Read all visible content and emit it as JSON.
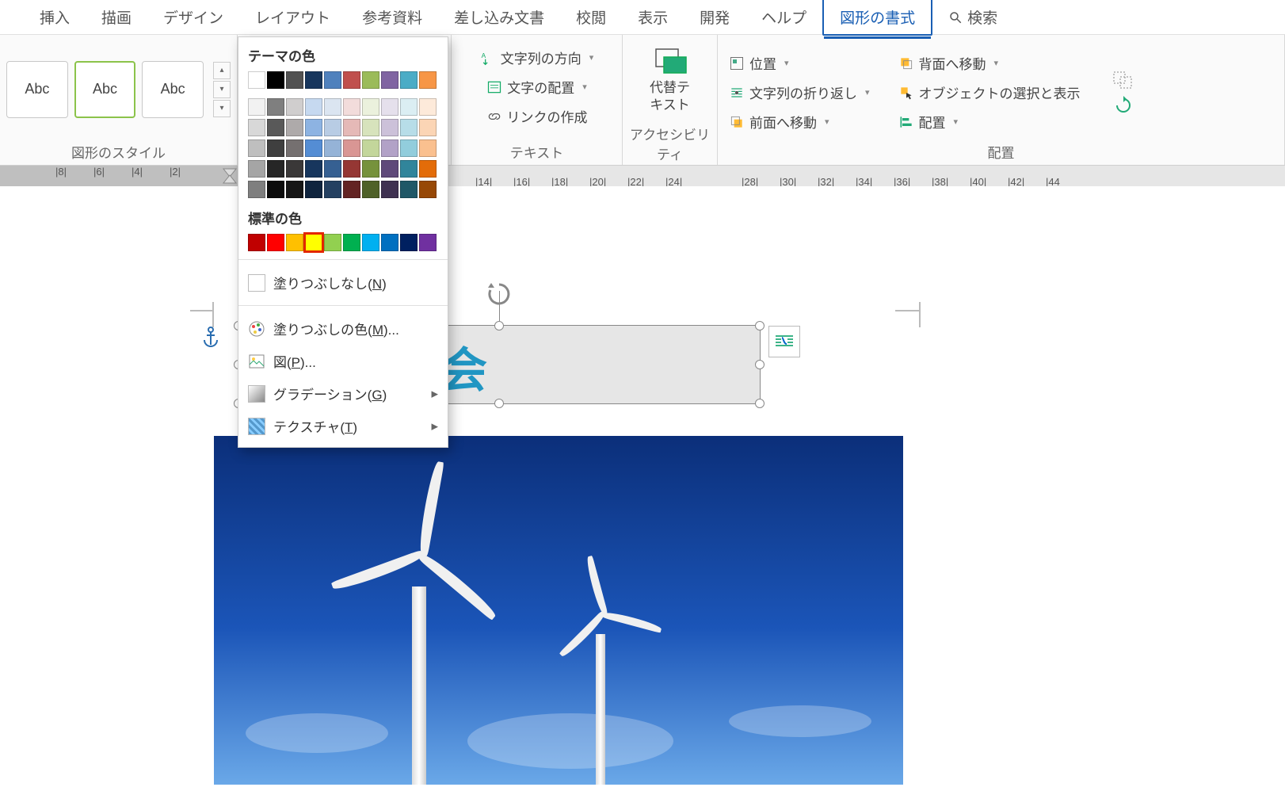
{
  "tabs": {
    "insert": "挿入",
    "draw": "描画",
    "design": "デザイン",
    "layout": "レイアウト",
    "references": "参考資料",
    "mailings": "差し込み文書",
    "review": "校閲",
    "view": "表示",
    "developer": "開発",
    "help": "ヘルプ",
    "shape_format": "図形の書式",
    "search": "検索"
  },
  "ribbon": {
    "shape_styles": {
      "label": "図形のスタイル",
      "abc": "Abc"
    },
    "text": {
      "label": "テキスト",
      "direction": "文字列の方向",
      "align": "文字の配置",
      "link": "リンクの作成"
    },
    "accessibility": {
      "label": "アクセシビリティ",
      "alt_text": "代替テ\nキスト"
    },
    "arrange": {
      "label": "配置",
      "position": "位置",
      "wrap": "文字列の折り返し",
      "bring_forward": "前面へ移動",
      "send_back": "背面へ移動",
      "selection_pane": "オブジェクトの選択と表示",
      "align": "配置"
    }
  },
  "ruler_marks_left": [
    "|8|",
    "|6|",
    "|4|",
    "|2|"
  ],
  "ruler_marks_right": [
    "|14|",
    "|16|",
    "|18|",
    "|20|",
    "|22|",
    "|24|",
    "|28|",
    "|30|",
    "|32|",
    "|34|",
    "|36|",
    "|38|",
    "|40|",
    "|42|",
    "|44"
  ],
  "color_menu": {
    "theme_title": "テーマの色",
    "standard_title": "標準の色",
    "no_fill": "塗りつぶしなし(N)",
    "more_colors": "塗りつぶしの色(M)...",
    "picture": "図(P)...",
    "gradient": "グラデーション(G)",
    "texture": "テクスチャ(T)",
    "theme_row1": [
      "#ffffff",
      "#000000",
      "#525252",
      "#17365d",
      "#4f81bd",
      "#c0504d",
      "#9bbb59",
      "#8064a2",
      "#4bacc6",
      "#f79646"
    ],
    "shades": [
      [
        "#f2f2f2",
        "#7f7f7f",
        "#d0cece",
        "#c6d9f0",
        "#dbe5f1",
        "#f2dcdb",
        "#ebf1dd",
        "#e5e0ec",
        "#dbeef3",
        "#fdeada"
      ],
      [
        "#d8d8d8",
        "#595959",
        "#aeaaaa",
        "#8db3e2",
        "#b8cce4",
        "#e5b9b7",
        "#d7e3bc",
        "#ccc1d9",
        "#b7dde8",
        "#fbd5b5"
      ],
      [
        "#bfbfbf",
        "#3f3f3f",
        "#757070",
        "#548dd4",
        "#95b3d7",
        "#d99694",
        "#c3d69b",
        "#b2a2c7",
        "#92cddc",
        "#fac08f"
      ],
      [
        "#a5a5a5",
        "#262626",
        "#3a3838",
        "#17365d",
        "#366092",
        "#953734",
        "#76923c",
        "#5f497a",
        "#31859b",
        "#e36c09"
      ],
      [
        "#7f7f7f",
        "#0c0c0c",
        "#161616",
        "#0f243e",
        "#244061",
        "#632423",
        "#4f6128",
        "#3f3151",
        "#205867",
        "#974806"
      ]
    ],
    "standard": [
      "#c00000",
      "#ff0000",
      "#ffc000",
      "#ffff00",
      "#92d050",
      "#00b050",
      "#00b0f0",
      "#0070c0",
      "#002060",
      "#7030a0"
    ]
  },
  "document": {
    "textbox_text": "電所見学会"
  }
}
